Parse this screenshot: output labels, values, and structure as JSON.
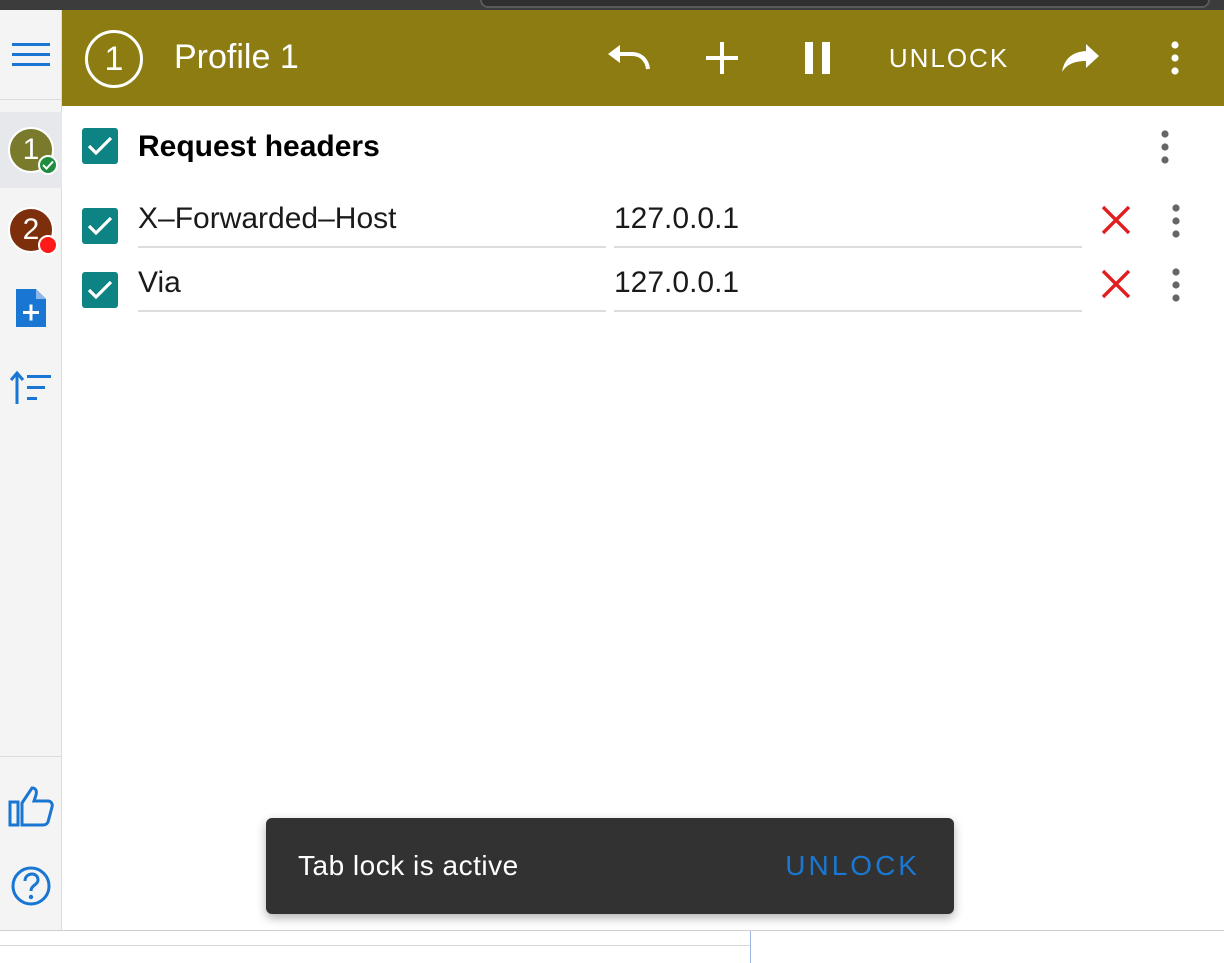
{
  "header": {
    "profile_number": "1",
    "title": "Profile 1",
    "unlock_label": "UNLOCK",
    "background_color": "#8c7c12"
  },
  "sidebar": {
    "profiles": [
      {
        "number": "1",
        "color": "#7a7a2c",
        "status": "active-check"
      },
      {
        "number": "2",
        "color": "#7d2e0a",
        "status": "red-dot"
      }
    ],
    "icons": [
      "menu-icon",
      "add-file-icon",
      "sort-icon",
      "thumbs-up-icon",
      "help-icon"
    ]
  },
  "filter_group": {
    "title": "Request headers",
    "headers": [
      {
        "name": "X–Forwarded–Host",
        "value": "127.0.0.1",
        "enabled": true
      },
      {
        "name": "Via",
        "value": "127.0.0.1",
        "enabled": true
      }
    ]
  },
  "snackbar": {
    "message": "Tab lock is active",
    "action": "UNLOCK"
  },
  "colors": {
    "accent": "#0e8383",
    "delete": "#e02020",
    "link": "#1a78d2",
    "sidebar_icon": "#1976d2"
  }
}
